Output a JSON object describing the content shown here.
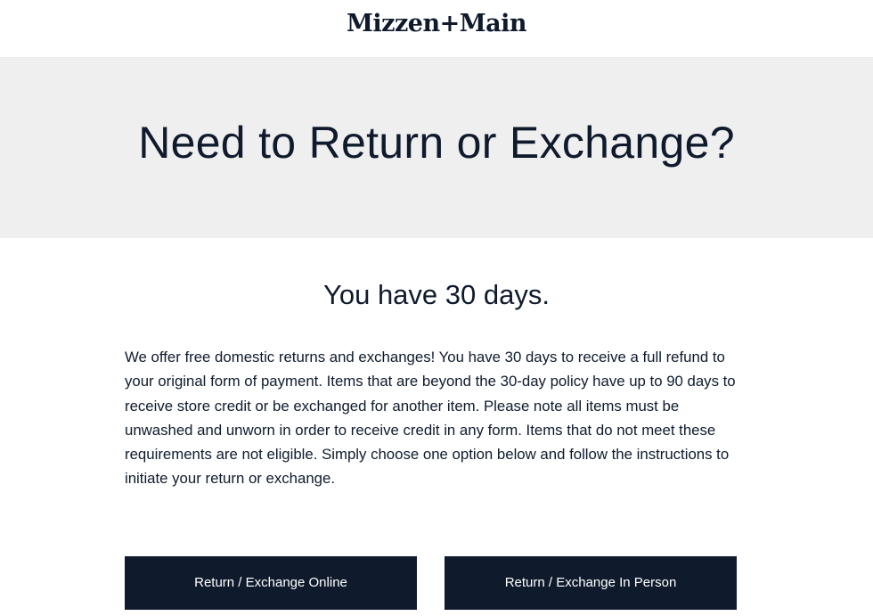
{
  "header": {
    "logo_text": "Mizzen+Main"
  },
  "hero": {
    "title": "Need to Return or Exchange?"
  },
  "main": {
    "subtitle": "You have 30 days.",
    "description": "We offer free domestic returns and exchanges! You have 30 days to receive a full refund to your original form of payment. Items that are beyond the 30-day policy have up to 90 days to receive store credit or be exchanged for another item. Please note all items must be unwashed and unworn in order to receive credit in any form. Items that do not meet these requirements are not eligible. Simply choose one option below and follow the instructions to initiate your return or exchange."
  },
  "actions": {
    "online_label": "Return / Exchange Online",
    "in_person_label": "Return / Exchange In Person"
  },
  "colors": {
    "brand_navy": "#0f1b2d",
    "hero_background": "#efefef"
  }
}
